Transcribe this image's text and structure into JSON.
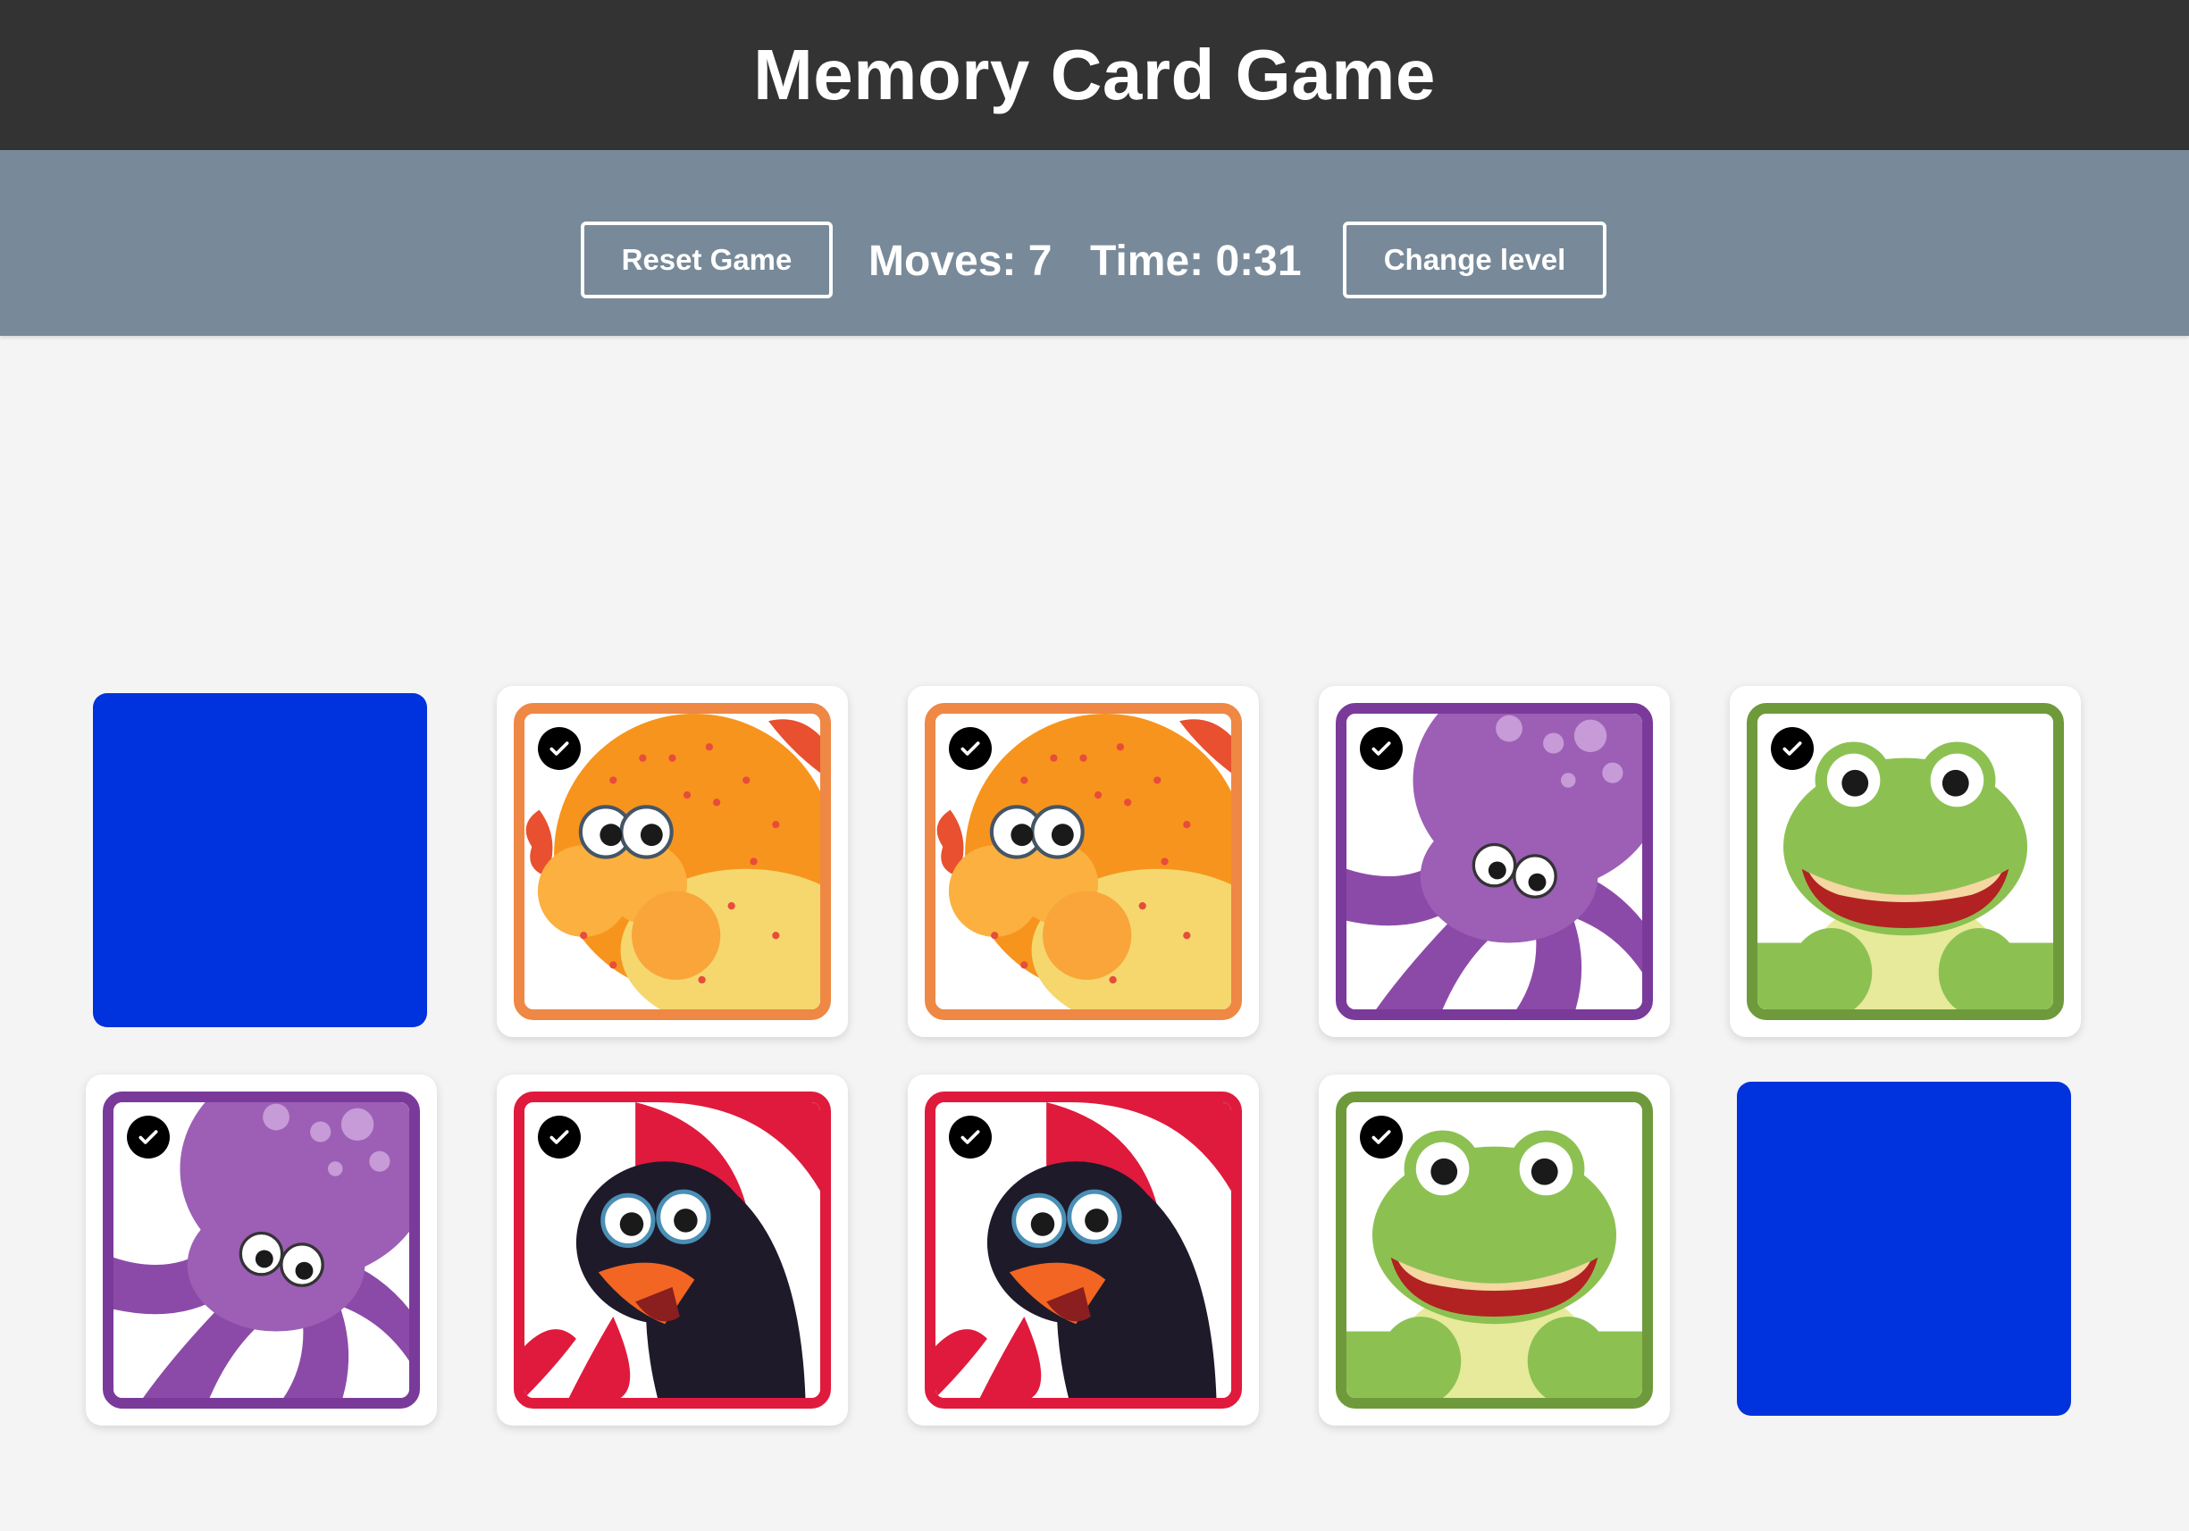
{
  "header": {
    "title": "Memory Card Game"
  },
  "toolbar": {
    "reset_label": "Reset Game",
    "moves_text": "Moves: 7",
    "time_text": "Time: 0:31",
    "change_level_label": "Change level"
  },
  "colors": {
    "header_bg": "#333333",
    "toolbar_bg": "#788a99",
    "page_bg": "#f4f4f4",
    "card_back": "#0033dd",
    "pufferfish_frame": "#ee8844",
    "octopus_frame": "#7a3a9a",
    "frog_frame": "#6f9a3c",
    "rooster_frame": "#e01a3c"
  },
  "board": {
    "rows": 2,
    "columns": 5,
    "cards": [
      {
        "state": "face-down"
      },
      {
        "state": "matched",
        "animal": "pufferfish"
      },
      {
        "state": "matched",
        "animal": "pufferfish"
      },
      {
        "state": "matched",
        "animal": "octopus"
      },
      {
        "state": "matched",
        "animal": "frog"
      },
      {
        "state": "matched",
        "animal": "octopus"
      },
      {
        "state": "matched",
        "animal": "rooster"
      },
      {
        "state": "matched",
        "animal": "rooster"
      },
      {
        "state": "matched",
        "animal": "frog"
      },
      {
        "state": "face-down"
      }
    ]
  }
}
